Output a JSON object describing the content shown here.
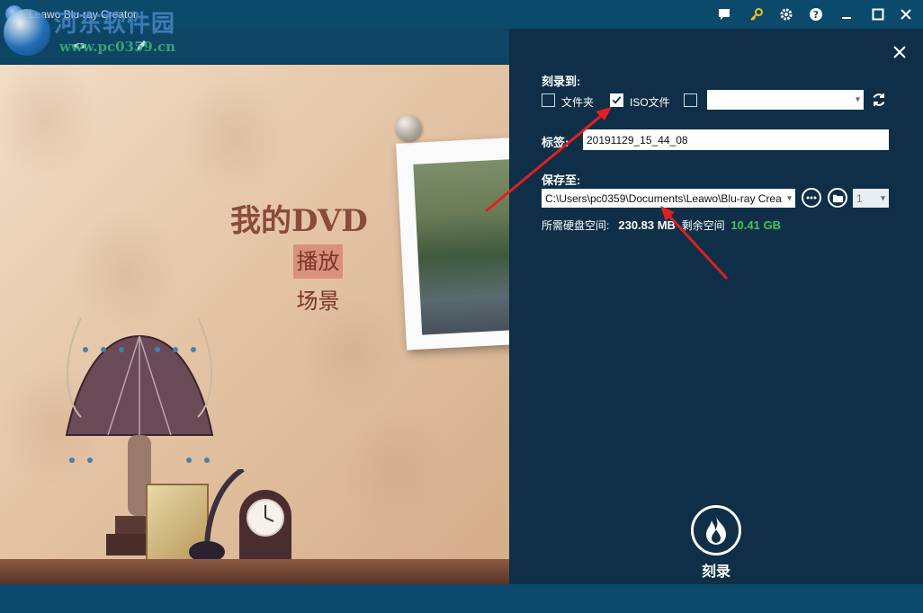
{
  "window": {
    "title": "Leawo Blu-ray Creator",
    "watermark_site": "河东软件园",
    "watermark_url": "www.pc0359.cn"
  },
  "titlebar_icons": [
    "chat-icon",
    "key-icon",
    "gear-icon",
    "help-icon",
    "minimize-icon",
    "maximize-icon",
    "close-icon"
  ],
  "preview": {
    "menu_title": "我的DVD",
    "menu_items": [
      "播放",
      "场景"
    ]
  },
  "settings": {
    "burn_to_label": "刻录到:",
    "options": [
      {
        "label": "文件夹",
        "checked": false
      },
      {
        "label": "ISO文件",
        "checked": true
      },
      {
        "label": "",
        "checked": false
      }
    ],
    "drive_select_value": "",
    "tag_label": "标签:",
    "tag_value": "20191129_15_44_08",
    "save_to_label": "保存至:",
    "save_path": "C:\\Users\\pc0359\\Documents\\Leawo\\Blu-ray Crea",
    "copies_value": "1",
    "required_space_label": "所需硬盘空间:",
    "required_space_value": "230.83 MB",
    "free_space_label": "剩余空间",
    "free_space_value": "10.41 GB",
    "burn_label": "刻录"
  },
  "colors": {
    "panel_bg": "#0e2f47",
    "titlebar_bg": "#0c4a6b",
    "free_space_green": "#3ec65a",
    "arrow_red": "#e02020",
    "accent_yellow": "#f2c21b"
  }
}
